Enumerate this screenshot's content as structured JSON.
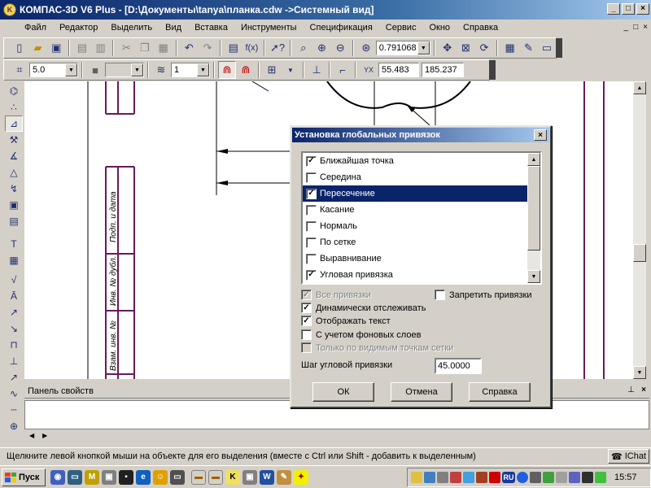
{
  "window": {
    "title": "КОМПАС-3D V6 Plus - [D:\\Документы\\tanya\\планка.cdw ->Системный вид]",
    "app_icon_label": "K",
    "buttons": [
      "_",
      "□",
      "×"
    ]
  },
  "menu": {
    "items": [
      "Файл",
      "Редактор",
      "Выделить",
      "Вид",
      "Вставка",
      "Инструменты",
      "Спецификация",
      "Сервис",
      "Окно",
      "Справка"
    ],
    "mdi_buttons": [
      "_",
      "□",
      "×"
    ]
  },
  "toolbar1": {
    "zoom_value": "0.791068"
  },
  "toolbar2": {
    "step_value": "5.0",
    "color_value": "",
    "layer_value": "1",
    "coord_x": "55.483",
    "coord_y": "185.237"
  },
  "properties_panel": {
    "title": "Панель свойств",
    "pin_glyph": "⊥",
    "close_glyph": "×"
  },
  "status_bar": {
    "message": "Щелкните левой кнопкой мыши на объекте для его выделения (вместе с Ctrl или Shift - добавить к выделенным)",
    "ichat_label": "IChat"
  },
  "taskbar": {
    "start_label": "Пуск",
    "language": "RU",
    "clock": "15:57"
  },
  "drawing": {
    "stamp_labels": [
      "Подп. и дата",
      "Инв. № дубл.",
      "Взам. инв. №"
    ]
  },
  "dialog": {
    "title": "Установка глобальных привязок",
    "close_glyph": "×",
    "snaps": [
      {
        "label": "Ближайшая точка",
        "checked": true,
        "selected": false
      },
      {
        "label": "Середина",
        "checked": false,
        "selected": false
      },
      {
        "label": "Пересечение",
        "checked": true,
        "selected": true
      },
      {
        "label": "Касание",
        "checked": false,
        "selected": false
      },
      {
        "label": "Нормаль",
        "checked": false,
        "selected": false
      },
      {
        "label": "По сетке",
        "checked": false,
        "selected": false
      },
      {
        "label": "Выравнивание",
        "checked": false,
        "selected": false
      },
      {
        "label": "Угловая привязка",
        "checked": true,
        "selected": false
      }
    ],
    "all_snaps": {
      "label": "Все привязки",
      "checked": true
    },
    "forbid_snaps": {
      "label": "Запретить привязки",
      "checked": false
    },
    "dynamic_tracking": {
      "label": "Динамически отслеживать",
      "checked": true
    },
    "show_text": {
      "label": "Отображать текст",
      "checked": true
    },
    "background_layers": {
      "label": "С учетом фоновых слоев",
      "checked": false
    },
    "visible_grid_only": {
      "label": "Только по видимым точкам сетки",
      "checked": false
    },
    "angle_step_label": "Шаг угловой привязки",
    "angle_step_value": "45.0000",
    "ok_label": "ОК",
    "cancel_label": "Отмена",
    "help_label": "Справка"
  }
}
